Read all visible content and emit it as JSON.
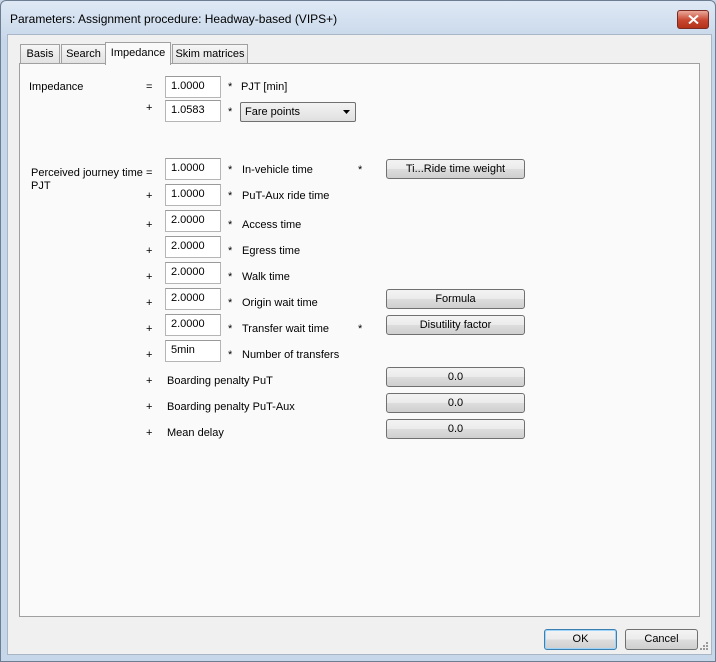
{
  "window": {
    "title": "Parameters: Assignment procedure: Headway-based (VIPS+)",
    "close_glyph": "✕"
  },
  "tabs": [
    {
      "label": "Basis",
      "active": false
    },
    {
      "label": "Search",
      "active": false
    },
    {
      "label": "Impedance",
      "active": true
    },
    {
      "label": "Skim matrices",
      "active": false
    }
  ],
  "impedance": {
    "label": "Impedance",
    "rows": [
      {
        "op": "=",
        "value": "1.0000",
        "mult": "*",
        "term": "PJT [min]"
      },
      {
        "op": "+",
        "value": "1.0583",
        "mult": "*",
        "select_value": "Fare points"
      }
    ]
  },
  "pjt": {
    "label_line1": "Perceived journey time",
    "label_line2": "PJT",
    "rows": [
      {
        "op": "=",
        "value": "1.0000",
        "mult": "*",
        "term": "In-vehicle time",
        "mult2": "*",
        "button": "Ti...Ride time weight"
      },
      {
        "op": "+",
        "value": "1.0000",
        "mult": "*",
        "term": "PuT-Aux ride time"
      },
      {
        "op": "+",
        "value": "2.0000",
        "mult": "*",
        "term": "Access time"
      },
      {
        "op": "+",
        "value": "2.0000",
        "mult": "*",
        "term": "Egress time"
      },
      {
        "op": "+",
        "value": "2.0000",
        "mult": "*",
        "term": "Walk time"
      },
      {
        "op": "+",
        "value": "2.0000",
        "mult": "*",
        "term": "Origin wait time",
        "button": "Formula"
      },
      {
        "op": "+",
        "value": "2.0000",
        "mult": "*",
        "term": "Transfer wait time",
        "mult2": "*",
        "button": "Disutility factor"
      },
      {
        "op": "+",
        "value": "5min",
        "mult": "*",
        "term": "Number of transfers"
      },
      {
        "op": "+",
        "term": "Boarding penalty PuT",
        "button": "0.0"
      },
      {
        "op": "+",
        "term": "Boarding penalty PuT-Aux",
        "button": "0.0"
      },
      {
        "op": "+",
        "term": "Mean delay",
        "button": "0.0"
      }
    ]
  },
  "footer": {
    "ok": "OK",
    "cancel": "Cancel"
  },
  "colors": {
    "accent": "#3c7fb1",
    "close": "#c8452f"
  }
}
